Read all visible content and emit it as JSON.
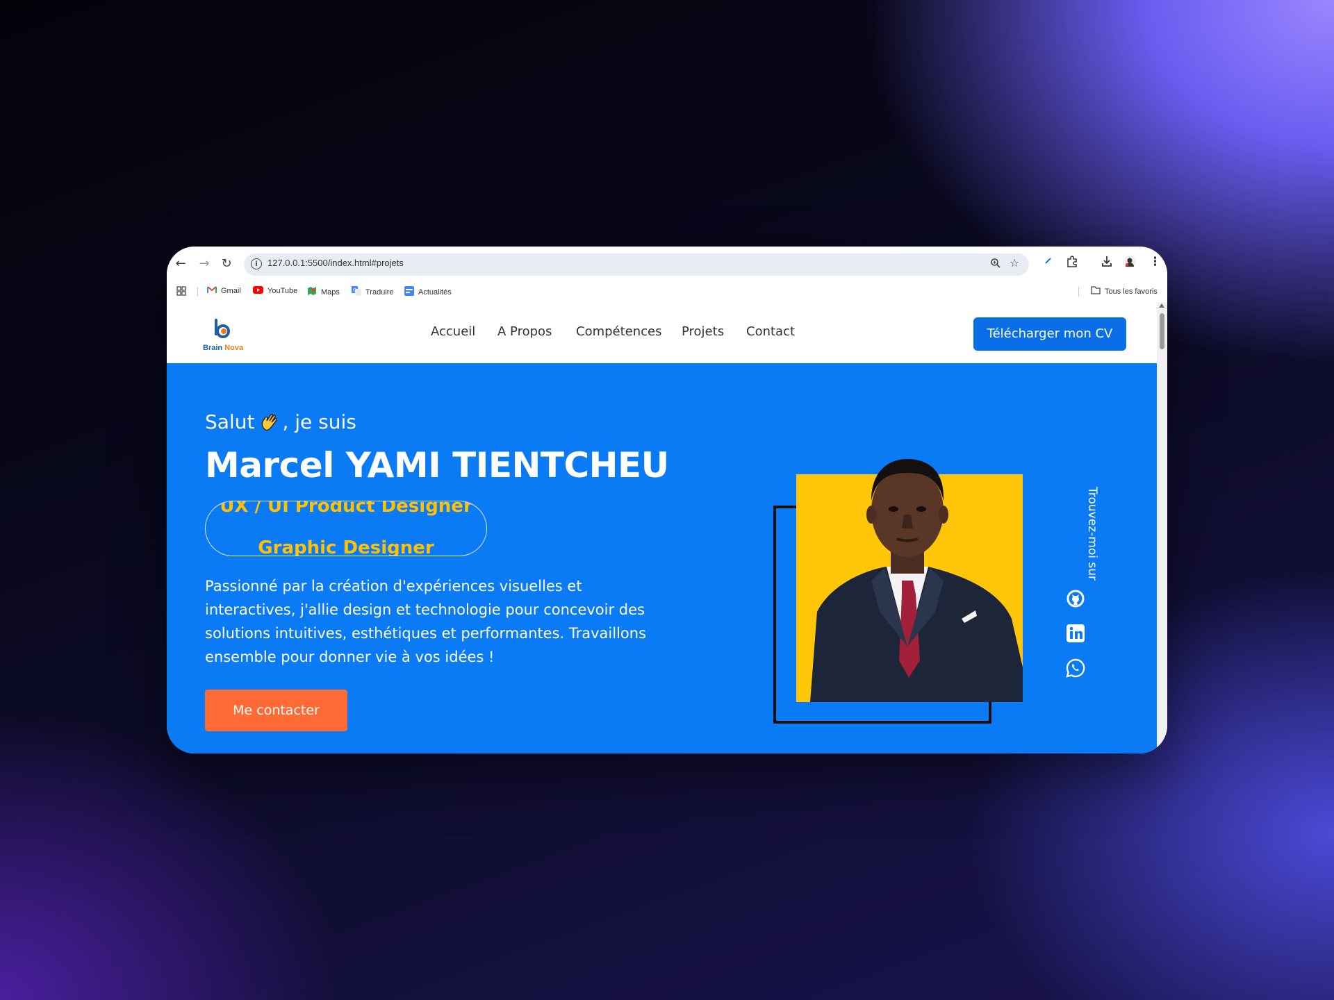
{
  "browser": {
    "url": "127.0.0.1:5500/index.html#projets",
    "bookmarks": [
      {
        "label": "Gmail",
        "icon": "gmail-icon",
        "color": "#ea4335"
      },
      {
        "label": "YouTube",
        "icon": "youtube-icon",
        "color": "#ff0000"
      },
      {
        "label": "Maps",
        "icon": "maps-icon",
        "color": "#34a853"
      },
      {
        "label": "Traduire",
        "icon": "translate-icon",
        "color": "#4285f4"
      },
      {
        "label": "Actualités",
        "icon": "news-icon",
        "color": "#4285f4"
      }
    ],
    "all_bookmarks_label": "Tous les favoris"
  },
  "site": {
    "logo_text_1": "Brain",
    "logo_text_2": "Nova",
    "nav": [
      "Accueil",
      "A Propos",
      "Compétences",
      "Projets",
      "Contact"
    ],
    "cv_button": "Télécharger mon CV",
    "hero": {
      "greeting_before": "Salut",
      "greeting_after": ", je suis",
      "name": "Marcel YAMI TIENTCHEU",
      "roles": [
        "UX / UI Product Designer",
        "Graphic Designer"
      ],
      "description": "Passionné par la création d'expériences visuelles et interactives, j'allie design et technologie pour concevoir des solutions intuitives, esthétiques et performantes. Travaillons ensemble pour donner vie à vos idées !",
      "contact_button": "Me contacter",
      "follow_label": "Trouvez-moi sur",
      "social_icons": [
        "github-icon",
        "linkedin-icon",
        "whatsapp-icon"
      ]
    }
  },
  "colors": {
    "primary_blue": "#0a7af5",
    "cta_orange": "#ff6a35",
    "accent_yellow": "#ffc107"
  }
}
